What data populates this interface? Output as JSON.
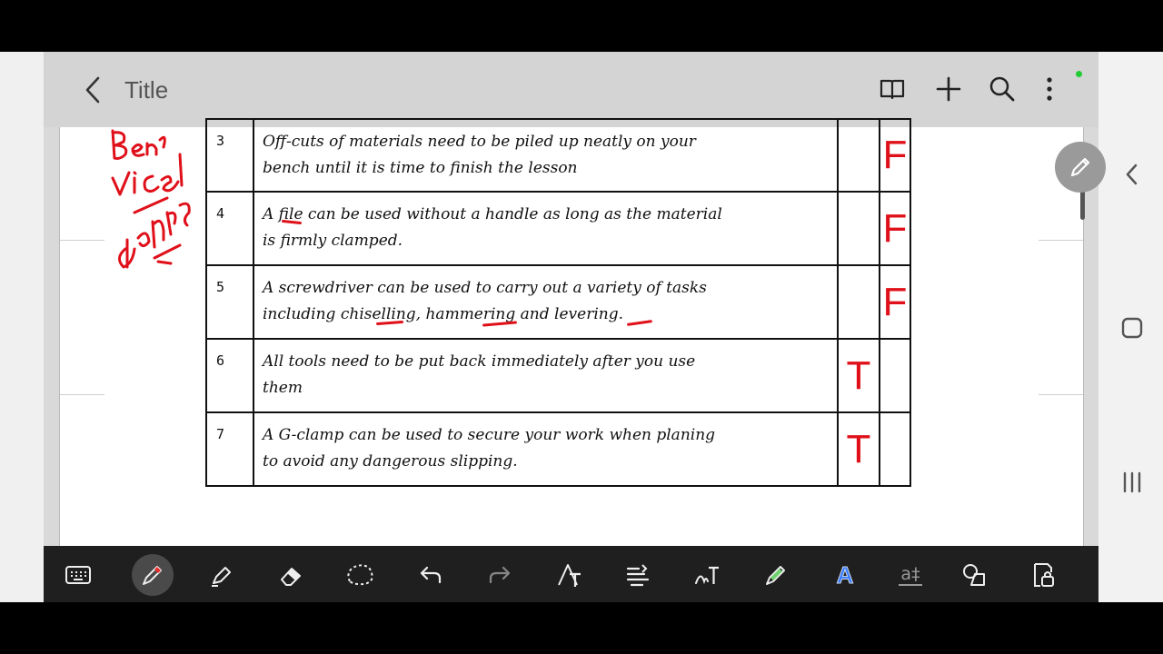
{
  "header": {
    "title": "Title"
  },
  "table": {
    "rows": [
      {
        "num": "3",
        "line1": "Off-cuts of materials need to be piled up neatly on your",
        "line2": "bench until it is time to finish the lesson",
        "true_mark": "",
        "false_mark": "F"
      },
      {
        "num": "4",
        "line1": "A file can be used without a handle as long as the material",
        "line2": "is firmly clamped.",
        "true_mark": "",
        "false_mark": "F"
      },
      {
        "num": "5",
        "line1": "A screwdriver can be used to carry out a variety of tasks",
        "line2": "including chiselling, hammering and levering.",
        "true_mark": "",
        "false_mark": "F"
      },
      {
        "num": "6",
        "line1": "All tools need to be put back immediately after you use",
        "line2": "them",
        "true_mark": "T",
        "false_mark": ""
      },
      {
        "num": "7",
        "line1": "A G-clamp can be used to secure your work when planing",
        "line2": "to avoid any dangerous slipping.",
        "true_mark": "T",
        "false_mark": ""
      }
    ]
  },
  "colors": {
    "annotation": "#e0101a",
    "header_bg": "#d4d4d4",
    "toolbar_bg": "#1f1f1f",
    "accent_blue": "#3a7bff"
  },
  "toolbar": {
    "tools": [
      "keyboard-icon",
      "pen-icon",
      "highlighter-icon",
      "eraser-icon",
      "lasso-icon",
      "undo-icon",
      "redo-icon",
      "text-shape-icon",
      "text-align-icon",
      "handwriting-to-text-icon",
      "color-pen-icon",
      "text-style-icon",
      "text-box-icon",
      "shapes-icon",
      "lock-icon"
    ],
    "text_style_label": "A",
    "text_box_label": "a‡"
  }
}
